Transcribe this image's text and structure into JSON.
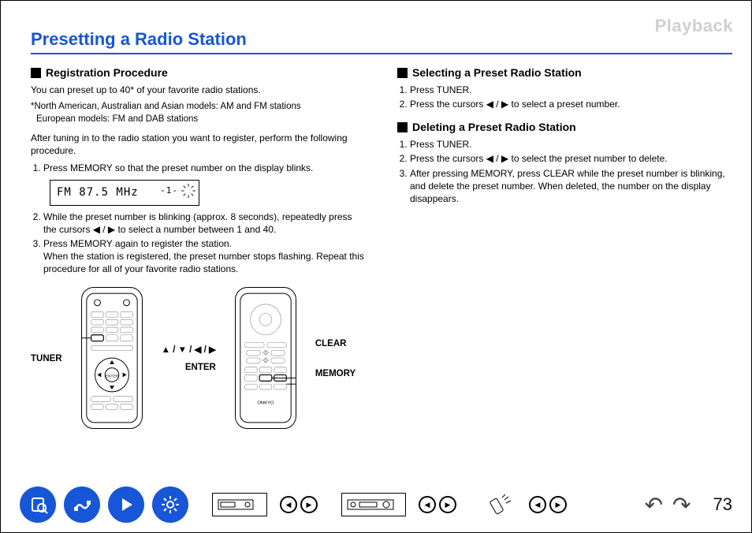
{
  "header": {
    "section": "Playback"
  },
  "title": "Presetting a Radio Station",
  "left": {
    "heading": "Registration Procedure",
    "intro": "You can preset up to 40* of your favorite radio stations.",
    "note_na": "*North American, Australian and Asian models: AM and FM stations",
    "note_eu": "European models: FM and DAB stations",
    "after": "After tuning in to the radio station you want to register, perform the following procedure.",
    "step1": "Press MEMORY so that the preset number on the display blinks.",
    "display_text": "FM 87.5 MHz",
    "display_preset": "-1-",
    "step2": "While the preset number is blinking (approx. 8 seconds), repeatedly press the cursors ◀ / ▶ to select a number between 1 and 40.",
    "step3": "Press MEMORY again to register the station.",
    "step3b": "When the station is registered, the preset number stops flashing. Repeat this procedure for all of your favorite radio stations.",
    "label_tuner": "TUNER",
    "label_cursor": "▲ / ▼ / ◀ / ▶",
    "label_enter": "ENTER",
    "label_clear": "CLEAR",
    "label_memory": "MEMORY"
  },
  "right": {
    "heading_select": "Selecting a Preset Radio Station",
    "sel_step1": "Press TUNER.",
    "sel_step2": "Press the cursors ◀ / ▶ to select a preset number.",
    "heading_delete": "Deleting a Preset Radio Station",
    "del_step1": "Press TUNER.",
    "del_step2": "Press the cursors ◀ / ▶ to select the preset number to delete.",
    "del_step3": "After pressing MEMORY, press CLEAR while the preset number is blinking, and delete the preset number. When deleted, the number on the display disappears."
  },
  "footer": {
    "page": "73",
    "icons": [
      "manual-icon",
      "connect-icon",
      "play-icon",
      "settings-icon"
    ]
  }
}
